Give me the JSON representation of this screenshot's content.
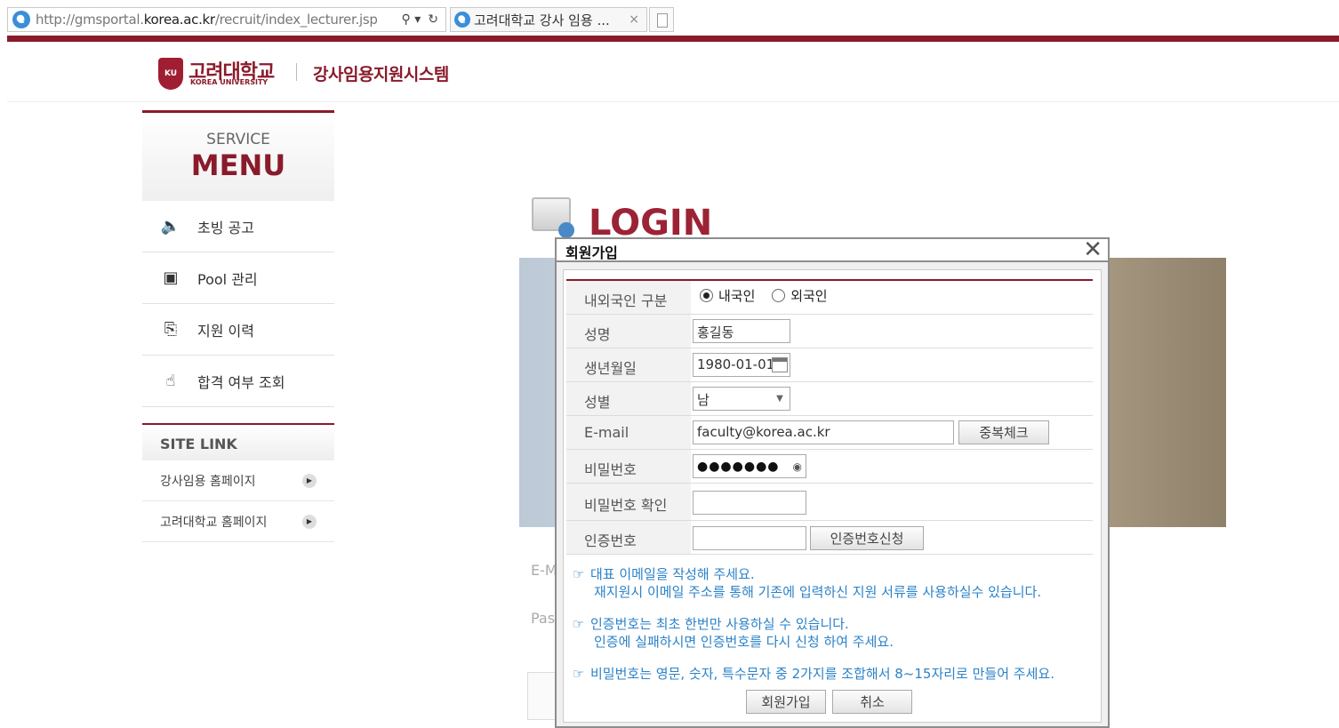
{
  "browser": {
    "url_prefix": "http://gmsportal.",
    "url_domain": "korea.ac.kr",
    "url_path": "/recruit/index_lecturer.jsp",
    "search_glyph": "⚲ ▾",
    "refresh_glyph": "↻",
    "tab_title": "고려대학교 강사 임용 ...",
    "tab_close": "×"
  },
  "header": {
    "logo_ko": "고려대학교",
    "logo_en": "KOREA UNIVERSITY",
    "system_title": "강사임용지원시스템"
  },
  "sidebar": {
    "service_label": "SERVICE",
    "menu_label": "MENU",
    "items": [
      {
        "label": "초빙 공고",
        "icon": "speaker-icon"
      },
      {
        "label": "Pool 관리",
        "icon": "computer-icon"
      },
      {
        "label": "지원 이력",
        "icon": "clipboard-icon"
      },
      {
        "label": "합격 여부 조회",
        "icon": "hand-pointer-icon"
      }
    ],
    "site_link_title": "SITE LINK",
    "site_links": [
      {
        "label": "강사임용 홈페이지"
      },
      {
        "label": "고려대학교 홈페이지"
      }
    ]
  },
  "login": {
    "title": "LOGIN",
    "email_label_partial": "E-M",
    "password_label_partial": "Pas"
  },
  "modal": {
    "title": "회원가입",
    "close": "✕",
    "fields": {
      "nationality_label": "내외국인 구분",
      "nationality_options": [
        "내국인",
        "외국인"
      ],
      "name_label": "성명",
      "name_value": "홍길동",
      "birth_label": "생년월일",
      "birth_value": "1980-01-01",
      "gender_label": "성별",
      "gender_value": "남",
      "email_label": "E-mail",
      "email_value": "faculty@korea.ac.kr",
      "dup_check_button": "중복체크",
      "password_label": "비밀번호",
      "password_value": "●●●●●●●",
      "password_confirm_label": "비밀번호 확인",
      "auth_label": "인증번호",
      "auth_request_button": "인증번호신청"
    },
    "notes": [
      {
        "line1": "대표 이메일을 작성해 주세요.",
        "line2": "재지원시 이메일 주소를 통해 기존에 입력하신 지원 서류를 사용하실수 있습니다."
      },
      {
        "line1": "인증번호는 최초 한번만 사용하실 수 있습니다.",
        "line2": "인증에 실패하시면 인증번호를 다시 신청 하여 주세요."
      },
      {
        "line1": "비밀번호는 영문, 숫자, 특수문자 중 2가지를 조합해서 8~15자리로 만들어 주세요.",
        "line2": ""
      }
    ],
    "note_icon": "☞",
    "submit_button": "회원가입",
    "cancel_button": "취소"
  }
}
